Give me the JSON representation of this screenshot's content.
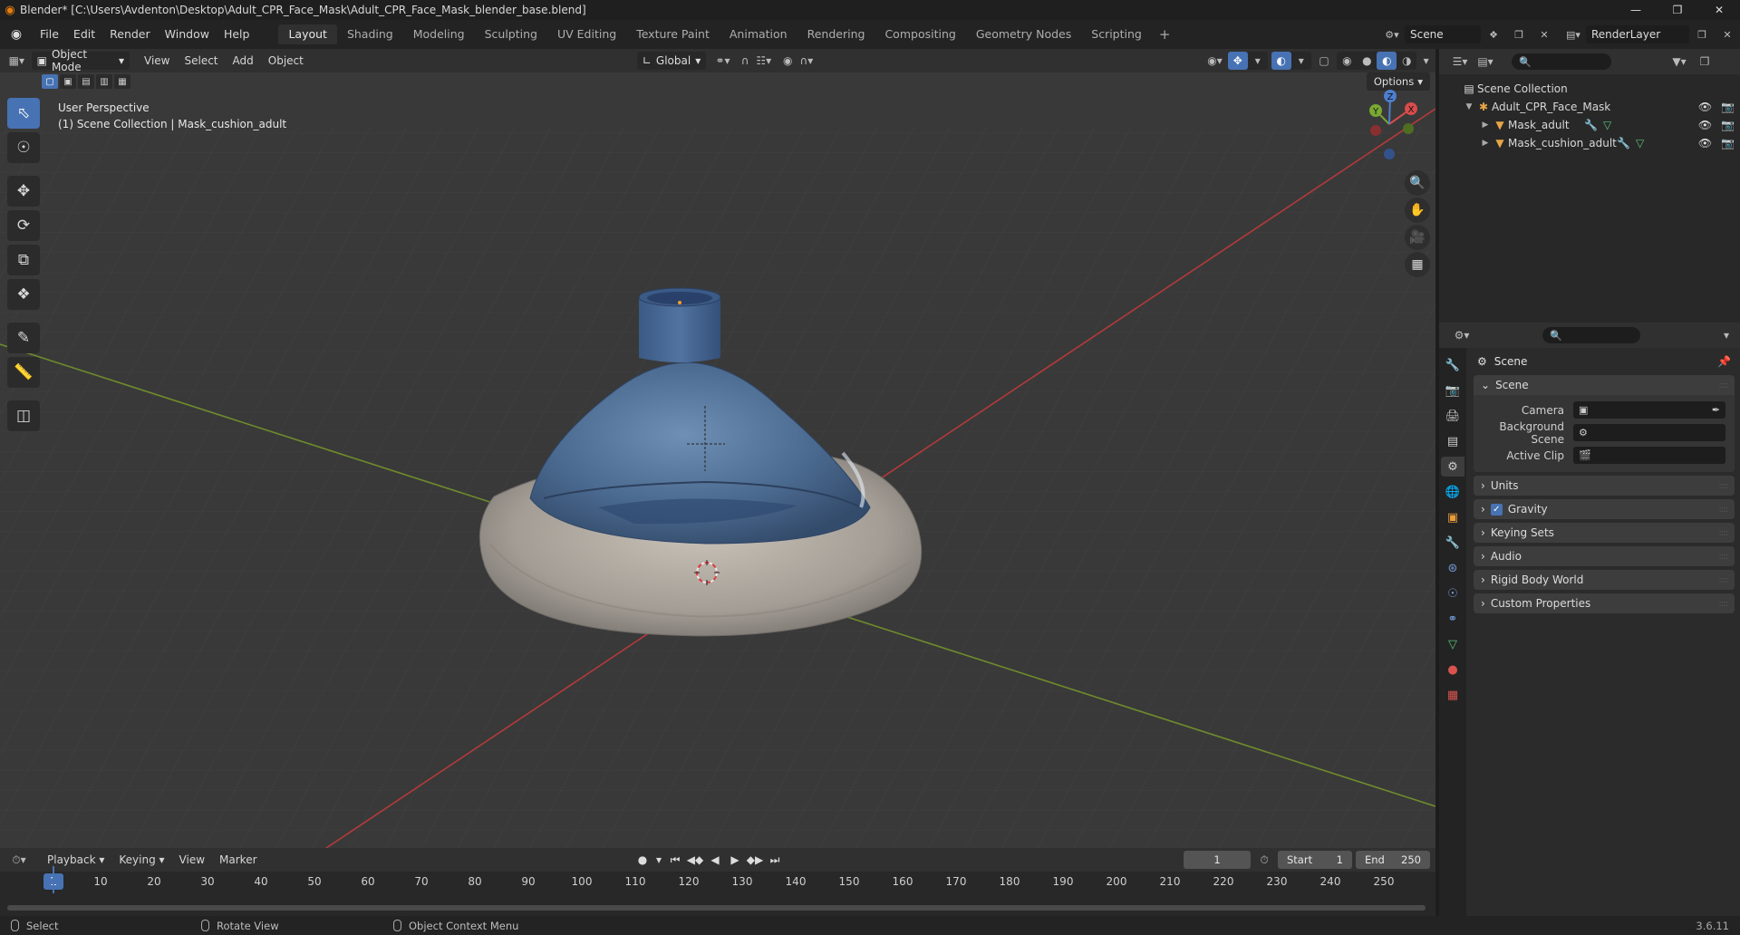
{
  "window": {
    "title": "Blender* [C:\\Users\\Avdenton\\Desktop\\Adult_CPR_Face_Mask\\Adult_CPR_Face_Mask_blender_base.blend]"
  },
  "menus": [
    "File",
    "Edit",
    "Render",
    "Window",
    "Help"
  ],
  "workspaces": [
    "Layout",
    "Shading",
    "Modeling",
    "Sculpting",
    "UV Editing",
    "Texture Paint",
    "Animation",
    "Rendering",
    "Compositing",
    "Geometry Nodes",
    "Scripting"
  ],
  "active_workspace": "Layout",
  "scene_name": "Scene",
  "view_layer": "RenderLayer",
  "viewport_header": {
    "mode": "Object Mode",
    "menus": [
      "View",
      "Select",
      "Add",
      "Object"
    ],
    "transform_orientation": "Global",
    "options_label": "Options"
  },
  "viewport": {
    "perspective": "User Perspective",
    "context": "(1) Scene Collection | Mask_cushion_adult",
    "gizmo_axes": [
      "X",
      "Y",
      "Z"
    ]
  },
  "outliner": {
    "root": "Scene Collection",
    "collection": "Adult_CPR_Face_Mask",
    "objects": [
      "Mask_adult",
      "Mask_cushion_adult"
    ]
  },
  "properties": {
    "context_title": "Scene",
    "scene_panel": {
      "title": "Scene",
      "camera_label": "Camera",
      "background_label": "Background Scene",
      "clip_label": "Active Clip"
    },
    "collapsed_panels": [
      "Units",
      "Gravity",
      "Keying Sets",
      "Audio",
      "Rigid Body World",
      "Custom Properties"
    ],
    "gravity_checked": true
  },
  "timeline": {
    "menus": [
      "Playback",
      "Keying",
      "View",
      "Marker"
    ],
    "current_frame": "1",
    "start_label": "Start",
    "start_value": "1",
    "end_label": "End",
    "end_value": "250",
    "ticks": [
      "10",
      "20",
      "30",
      "40",
      "50",
      "60",
      "70",
      "80",
      "90",
      "100",
      "110",
      "120",
      "130",
      "140",
      "150",
      "160",
      "170",
      "180",
      "190",
      "200",
      "210",
      "220",
      "230",
      "240",
      "250"
    ]
  },
  "statusbar": {
    "select": "Select",
    "rotate": "Rotate View",
    "context_menu": "Object Context Menu",
    "version": "3.6.11"
  }
}
